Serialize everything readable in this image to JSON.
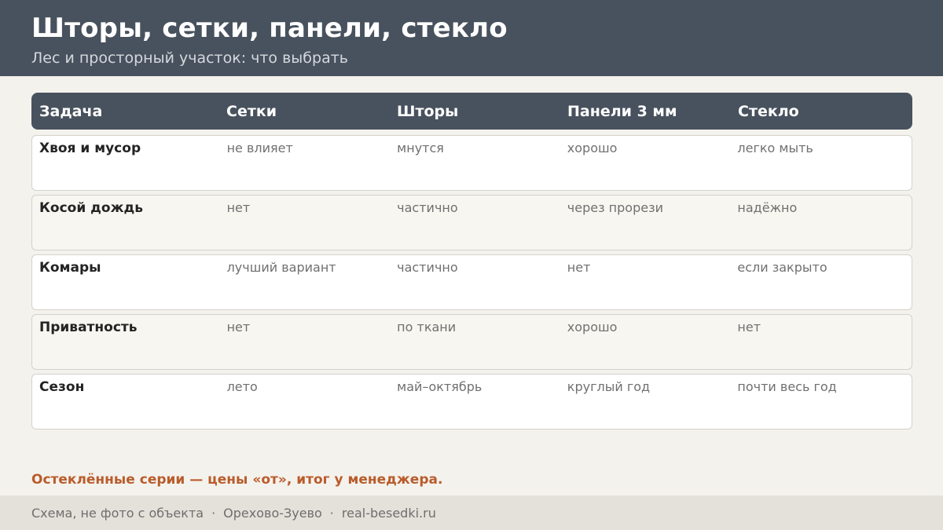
{
  "header": {
    "title": "Шторы, сетки, панели, стекло",
    "subtitle": "Лес и просторный участок: что выбрать"
  },
  "table": {
    "columns": [
      "Задача",
      "Сетки",
      "Шторы",
      "Панели 3 мм",
      "Стекло"
    ],
    "rows": [
      [
        "Хвоя и мусор",
        "не влияет",
        "мнутся",
        "хорошо",
        "легко мыть"
      ],
      [
        "Косой дождь",
        "нет",
        "частично",
        "через прорези",
        "надёжно"
      ],
      [
        "Комары",
        "лучший вариант",
        "частично",
        "нет",
        "если закрыто"
      ],
      [
        "Приватность",
        "нет",
        "по ткани",
        "хорошо",
        "нет"
      ],
      [
        "Сезон",
        "лето",
        "май–октябрь",
        "круглый год",
        "почти весь год"
      ]
    ]
  },
  "note": "Остеклённые серии — цены «от», итог у менеджера.",
  "footer": {
    "items": [
      "Схема, не фото с объекта",
      "Орехово-Зуево",
      "real-besedki.ru"
    ],
    "separator": "·"
  },
  "colors": {
    "header_bg": "#48525e",
    "accent": "#b95c2b",
    "page_bg": "#f4f2ed",
    "footer_bg": "#e4e1da"
  }
}
